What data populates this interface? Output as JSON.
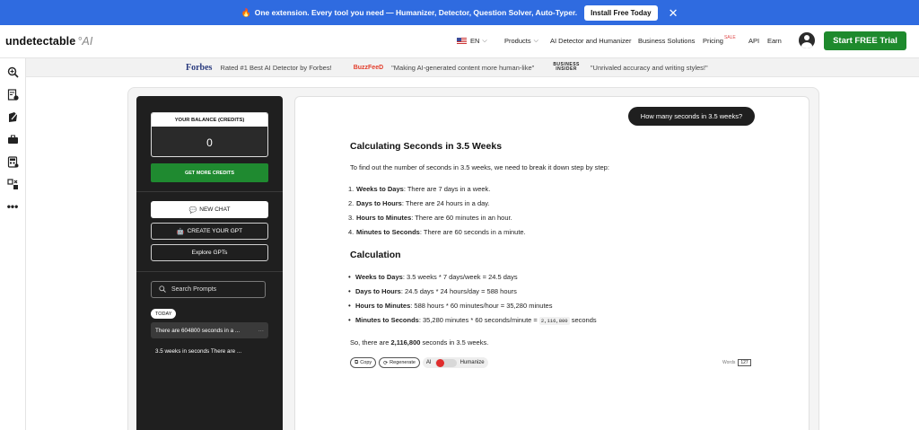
{
  "promo": {
    "text": "One extension. Every tool you need — Humanizer, Detector, Question Solver, Auto-Typer.",
    "install_label": "Install Free Today",
    "close_icon": "close-icon"
  },
  "header": {
    "logo_main": "undetectable",
    "logo_ai": "AI",
    "lang": "EN",
    "nav": [
      "Products",
      "AI Detector and Humanizer",
      "Business Solutions",
      "Pricing",
      "API",
      "Earn"
    ],
    "sale_badge": "SALE",
    "cta": "Start FREE Trial"
  },
  "rail": {
    "icons": [
      "search-icon",
      "detector-icon",
      "humanizer-icon",
      "briefcase-icon",
      "calculator-icon",
      "tools-icon",
      "more-icon"
    ]
  },
  "press": {
    "forbes": "Forbes",
    "forbes_quote": "Rated #1 Best AI Detector by Forbes!",
    "buzzfeed": "BuzzFeeD",
    "buzzfeed_quote": "\"Making AI-generated content more human-like\"",
    "bi_line1": "BUSINESS",
    "bi_line2": "INSIDER",
    "bi_quote": "\"Unrivaled accuracy and writing styles!\""
  },
  "sidebar": {
    "balance_label": "YOUR BALANCE (CREDITS)",
    "balance_value": "0",
    "get_credits": "GET MORE CREDITS",
    "new_chat": "NEW CHAT",
    "create_gpt": "CREATE YOUR GPT",
    "explore": "Explore GPTs",
    "search_placeholder": "Search Prompts",
    "today": "TODAY",
    "history": [
      "There are 604800 seconds in a ...",
      "3.5 weeks in seconds There are ..."
    ]
  },
  "chat": {
    "question": "How many seconds in 3.5 weeks?",
    "title": "Calculating Seconds in 3.5 Weeks",
    "intro": "To find out the number of seconds in 3.5 weeks, we need to break it down step by step:",
    "steps": [
      {
        "num": "1.",
        "bold": "Weeks to Days",
        "text": ": There are 7 days in a week."
      },
      {
        "num": "2.",
        "bold": "Days to Hours",
        "text": ": There are 24 hours in a day."
      },
      {
        "num": "3.",
        "bold": "Hours to Minutes",
        "text": ": There are 60 minutes in an hour."
      },
      {
        "num": "4.",
        "bold": "Minutes to Seconds",
        "text": ": There are 60 seconds in a minute."
      }
    ],
    "calc_title": "Calculation",
    "calc": [
      {
        "bold": "Weeks to Days",
        "text": ": 3.5 weeks * 7 days/week = 24.5 days"
      },
      {
        "bold": "Days to Hours",
        "text": ": 24.5 days * 24 hours/day = 588 hours"
      },
      {
        "bold": "Hours to Minutes",
        "text": ": 588 hours * 60 minutes/hour = 35,280 minutes"
      },
      {
        "bold": "Minutes to Seconds",
        "text": ": 35,280 minutes * 60 seconds/minute = ",
        "code": "2,116,800",
        "after": " seconds"
      }
    ],
    "conclusion_pre": "So, there are ",
    "conclusion_bold": "2,116,800",
    "conclusion_post": " seconds in 3.5 weeks.",
    "copy": "Copy",
    "regenerate": "Regenerate",
    "toggle_left": "AI",
    "toggle_right": "Humanize",
    "words_label": "Words",
    "words_count": "127"
  }
}
